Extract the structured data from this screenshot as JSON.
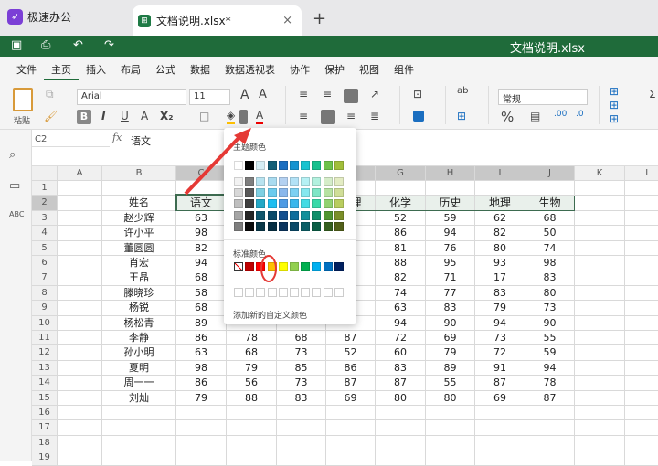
{
  "tabs": {
    "app_label": "极速办公",
    "doc_label": "文档说明.xlsx*",
    "close": "×",
    "new": "+"
  },
  "titlebar": {
    "title": "文档说明.xlsx"
  },
  "menu": [
    "文件",
    "主页",
    "插入",
    "布局",
    "公式",
    "数据",
    "数据透视表",
    "协作",
    "保护",
    "视图",
    "组件"
  ],
  "ribbon": {
    "paste": "粘贴",
    "font": "Arial",
    "size": "11",
    "number_format": "常规",
    "bold": "B",
    "italic": "I",
    "underline": "U",
    "strike": "A",
    "sub": "X₂",
    "percent": "%",
    "grow": "A",
    "shrink": "A",
    "font_color": "A"
  },
  "formula": {
    "cell": "C2",
    "fx": "fx",
    "value": "语文"
  },
  "columns": [
    "A",
    "B",
    "C",
    "D",
    "E",
    "F",
    "G",
    "H",
    "I",
    "J",
    "K",
    "L"
  ],
  "rows": [
    [
      "",
      "",
      "",
      "",
      "",
      "",
      "",
      "",
      "",
      ""
    ],
    [
      "",
      "姓名",
      "语文",
      "",
      "",
      "物理",
      "化学",
      "历史",
      "地理",
      "生物"
    ],
    [
      "",
      "赵少辉",
      "63",
      "",
      "",
      "",
      "52",
      "59",
      "62",
      "68"
    ],
    [
      "",
      "许小平",
      "98",
      "",
      "",
      "",
      "86",
      "94",
      "82",
      "50"
    ],
    [
      "",
      "董圆圆",
      "82",
      "",
      "",
      "",
      "81",
      "76",
      "80",
      "74"
    ],
    [
      "",
      "肖宏",
      "94",
      "",
      "",
      "",
      "88",
      "95",
      "93",
      "98"
    ],
    [
      "",
      "王晶",
      "68",
      "",
      "",
      "",
      "82",
      "71",
      "17",
      "83"
    ],
    [
      "",
      "滕晓珍",
      "58",
      "",
      "",
      "",
      "74",
      "77",
      "83",
      "80"
    ],
    [
      "",
      "杨锐",
      "68",
      "",
      "",
      "",
      "63",
      "83",
      "79",
      "73"
    ],
    [
      "",
      "杨松青",
      "89",
      "",
      "",
      "",
      "94",
      "90",
      "94",
      "90"
    ],
    [
      "",
      "李静",
      "86",
      "78",
      "68",
      "87",
      "72",
      "69",
      "73",
      "55"
    ],
    [
      "",
      "孙小明",
      "63",
      "68",
      "73",
      "52",
      "60",
      "79",
      "72",
      "59"
    ],
    [
      "",
      "夏明",
      "98",
      "79",
      "85",
      "86",
      "83",
      "89",
      "91",
      "94"
    ],
    [
      "",
      "周一一",
      "86",
      "56",
      "73",
      "87",
      "87",
      "55",
      "87",
      "78"
    ],
    [
      "",
      "刘灿",
      "79",
      "88",
      "83",
      "69",
      "80",
      "80",
      "69",
      "87"
    ],
    [
      "",
      "",
      "",
      "",
      "",
      "",
      "",
      "",
      "",
      ""
    ],
    [
      "",
      "",
      "",
      "",
      "",
      "",
      "",
      "",
      "",
      ""
    ],
    [
      "",
      "",
      "",
      "",
      "",
      "",
      "",
      "",
      "",
      ""
    ],
    [
      "",
      "",
      "",
      "",
      "",
      "",
      "",
      "",
      "",
      ""
    ]
  ],
  "color_popup": {
    "theme_label": "主题颜色",
    "standard_label": "标准颜色",
    "custom_label": "添加新的自定义颜色",
    "theme_top": [
      "#ffffff",
      "#000000",
      "#d6eef5",
      "#135f78",
      "#1a6ec0",
      "#1693d0",
      "#19c3cf",
      "#17c08e",
      "#6cc24a",
      "#a1be3a"
    ],
    "theme_shades": [
      [
        "#f2f2f2",
        "#7f7f7f",
        "#b8e3f0",
        "#a9dbf0",
        "#b4d1f1",
        "#b3e2f6",
        "#b6f1f4",
        "#b3f1df",
        "#d5edc9",
        "#e3ecc3"
      ],
      [
        "#d8d8d8",
        "#595959",
        "#7fd0e3",
        "#6ccbee",
        "#8ab8ec",
        "#7cd0f2",
        "#86e8ef",
        "#7fe6c6",
        "#b6e2a1",
        "#d0de98"
      ],
      [
        "#bfbfbf",
        "#3f3f3f",
        "#25a8c6",
        "#1ebef0",
        "#4e9be4",
        "#3ab7ec",
        "#45dbe4",
        "#3ad9a8",
        "#90d270",
        "#b9cd5f"
      ],
      [
        "#a5a5a5",
        "#262626",
        "#10566d",
        "#0a4a6a",
        "#124f8f",
        "#0f6e9c",
        "#128f9a",
        "#118f6a",
        "#4f9530",
        "#7b8f28"
      ],
      [
        "#7f7f7f",
        "#0c0c0c",
        "#0a3848",
        "#072f44",
        "#0b355f",
        "#0a4968",
        "#0c5f66",
        "#0b5f46",
        "#355f20",
        "#52601a"
      ]
    ],
    "standard": [
      "none",
      "#c00000",
      "#ff0000",
      "#ffc000",
      "#ffff00",
      "#92d050",
      "#00b050",
      "#00b0f0",
      "#0070c0",
      "#002060"
    ]
  },
  "accent": "#1f6b3a"
}
